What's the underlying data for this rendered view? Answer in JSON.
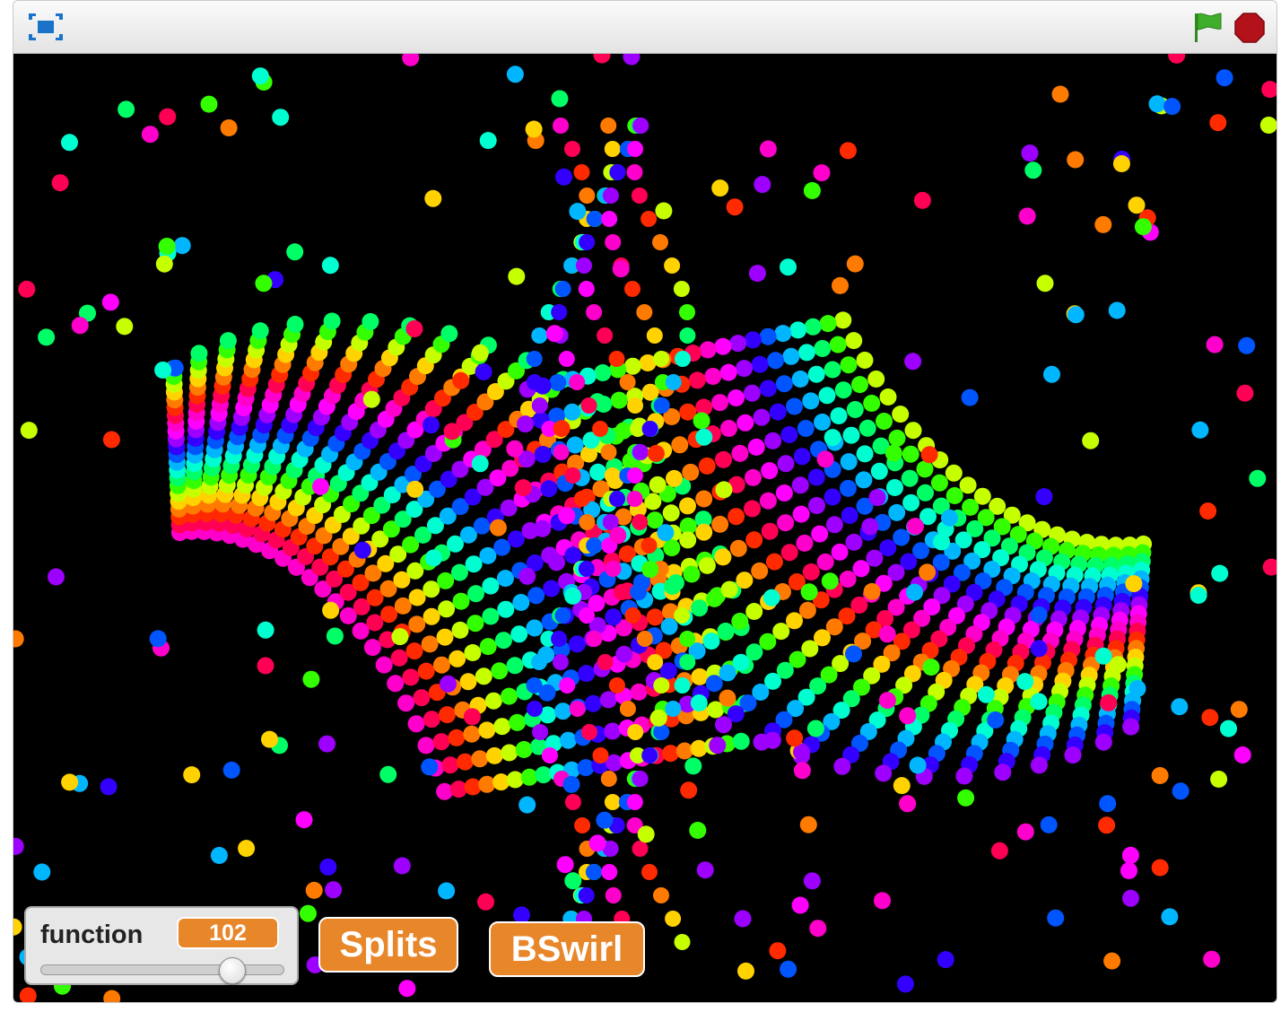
{
  "titlebar": {
    "fullscreen_icon": "fullscreen-icon",
    "flag_icon": "green-flag-icon",
    "stop_icon": "stop-icon",
    "flag_color": "#3fae2a",
    "stop_color": "#b3121b"
  },
  "stage": {
    "background": "#000000",
    "dot_palette": [
      "#ff00cc",
      "#ff0055",
      "#ff2a00",
      "#ff7a00",
      "#ffd200",
      "#c6ff00",
      "#33ff00",
      "#00ff66",
      "#00ffd0",
      "#00b7ff",
      "#0055ff",
      "#3300ff",
      "#9d00ff",
      "#ff00ff"
    ]
  },
  "monitor": {
    "label": "function",
    "value": "102",
    "slider_fraction": 0.79
  },
  "buttons": {
    "splits_label": "Splits",
    "bswirl_label": "BSwirl",
    "color": "#e8862a"
  }
}
